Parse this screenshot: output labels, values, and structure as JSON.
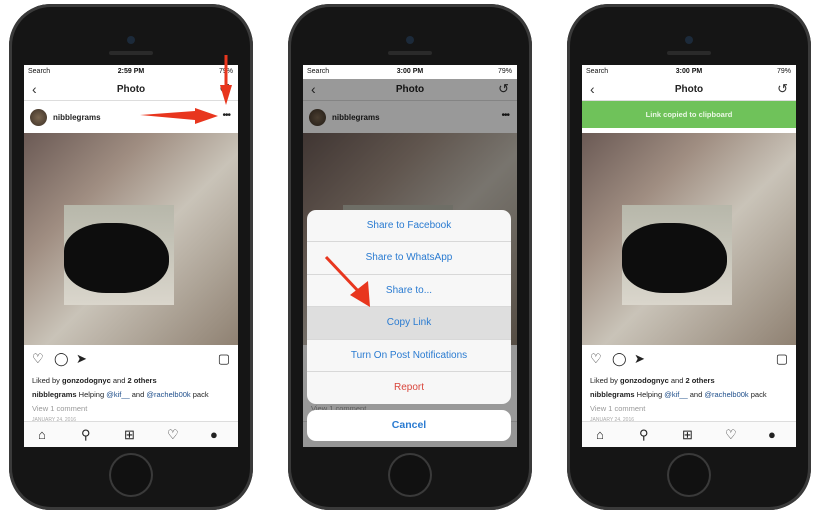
{
  "accent_color": "#2a7bd1",
  "toast_color": "#6fc25a",
  "arrow_color": "#e8361e",
  "phones": [
    {
      "status": {
        "carrier": "Search",
        "time": "2:59 PM",
        "battery": "79%"
      },
      "nav_title": "Photo",
      "username": "nibblegrams",
      "liked": {
        "prefix": "Liked by ",
        "user": "gonzodognyc",
        "mid": " and ",
        "others": "2 others"
      },
      "caption": {
        "user": "nibblegrams",
        "text1": " Helping ",
        "m1": "@kif__",
        "text2": " and ",
        "m2": "@rachelb00k",
        "text3": " pack"
      },
      "view_comments": "View 1 comment",
      "date": "JANUARY 24, 2016"
    },
    {
      "status": {
        "carrier": "Search",
        "time": "3:00 PM",
        "battery": "79%"
      },
      "nav_title": "Photo",
      "username": "nibblegrams",
      "view_comments": "View 1 comment",
      "action_sheet": {
        "items": [
          "Share to Facebook",
          "Share to WhatsApp",
          "Share to...",
          "Copy Link",
          "Turn On Post Notifications",
          "Report"
        ],
        "highlighted": "Copy Link",
        "cancel": "Cancel"
      }
    },
    {
      "status": {
        "carrier": "Search",
        "time": "3:00 PM",
        "battery": "79%"
      },
      "nav_title": "Photo",
      "username": "nibblegrams",
      "toast": "Link copied to clipboard",
      "liked": {
        "prefix": "Liked by ",
        "user": "gonzodognyc",
        "mid": " and ",
        "others": "2 others"
      },
      "caption": {
        "user": "nibblegrams",
        "text1": " Helping ",
        "m1": "@kif__",
        "text2": " and ",
        "m2": "@rachelb00k",
        "text3": " pack"
      },
      "view_comments": "View 1 comment",
      "date": "JANUARY 24, 2016"
    }
  ]
}
